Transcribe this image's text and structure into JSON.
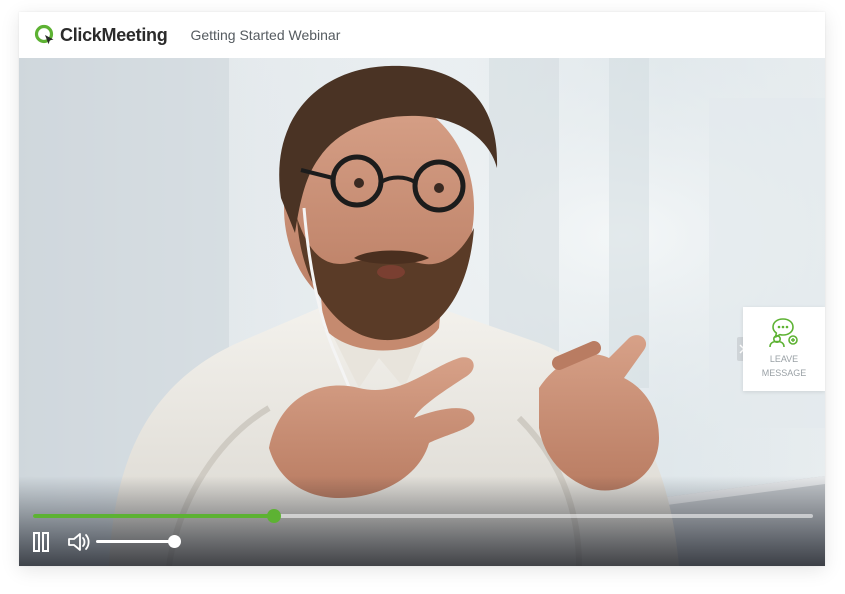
{
  "header": {
    "logo_text": "ClickMeeting",
    "webinar_title": "Getting Started Webinar"
  },
  "player": {
    "progress": 0.309,
    "volume": 1.0,
    "state": "playing",
    "pause_icon": "pause-icon",
    "volume_icon": "volume-icon",
    "accent_color": "#5db233"
  },
  "side_panel": {
    "label": "LEAVE MESSAGE",
    "icon": "chat-person-icon",
    "expand_icon": "chevron-right-icon"
  },
  "colors": {
    "brand_green": "#5db233",
    "text_dark": "#2b2b2b",
    "text_muted": "#555b60"
  }
}
